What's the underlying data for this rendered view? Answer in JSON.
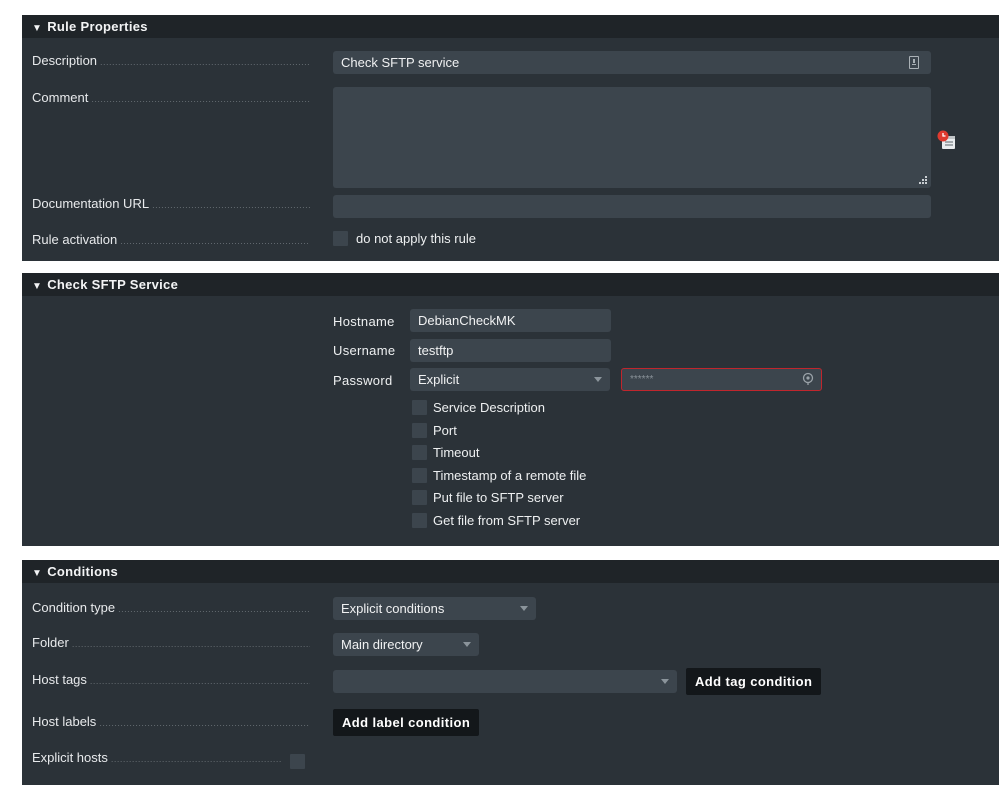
{
  "rule_properties": {
    "header": "Rule Properties",
    "description_label": "Description",
    "description_value": "Check SFTP service",
    "comment_label": "Comment",
    "comment_value": "",
    "documentation_url_label": "Documentation URL",
    "documentation_url_value": "",
    "rule_activation_label": "Rule activation",
    "rule_activation_checkbox_label": "do not apply this rule"
  },
  "check_sftp": {
    "header": "Check SFTP Service",
    "hostname_label": "Hostname",
    "hostname_value": "DebianCheckMK",
    "username_label": "Username",
    "username_value": "testftp",
    "password_label": "Password",
    "password_mode": "Explicit",
    "password_value": "******",
    "options": [
      "Service Description",
      "Port",
      "Timeout",
      "Timestamp of a remote file",
      "Put file to SFTP server",
      "Get file from SFTP server"
    ]
  },
  "conditions": {
    "header": "Conditions",
    "condition_type_label": "Condition type",
    "condition_type_value": "Explicit conditions",
    "folder_label": "Folder",
    "folder_value": "Main directory",
    "host_tags_label": "Host tags",
    "host_tags_value": "",
    "add_tag_condition": "Add tag condition",
    "host_labels_label": "Host labels",
    "add_label_condition": "Add label condition",
    "explicit_hosts_label": "Explicit hosts"
  },
  "colors": {
    "panel_bg": "#2b3238",
    "header_bg": "#1f2428",
    "input_bg": "#3c454d",
    "button_bg": "#13171a",
    "password_error_border": "#c0262d"
  }
}
